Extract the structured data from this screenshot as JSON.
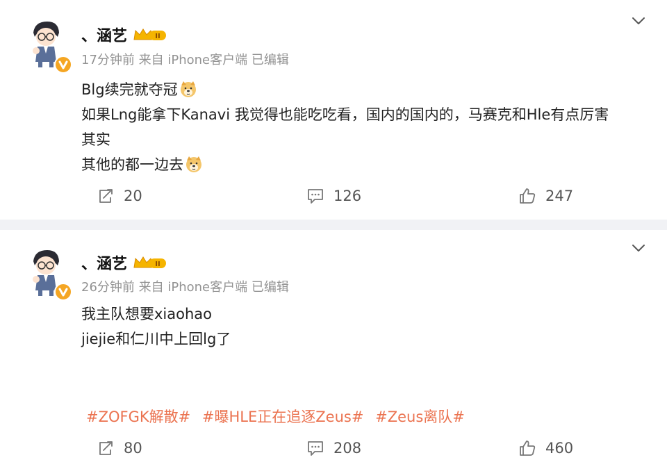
{
  "posts": [
    {
      "username": "、涵艺",
      "time": "17分钟前",
      "source": "来自 iPhone客户端",
      "edited": "已编辑",
      "lines": [
        "Blg续完就夺冠",
        "如果Lng能拿下Kanavi 我觉得也能吃吃看，国内的国内的，马赛克和Hle有点厉害",
        "其实",
        "其他的都一边去"
      ],
      "repost_count": "20",
      "comment_count": "126",
      "like_count": "247"
    },
    {
      "username": "、涵艺",
      "time": "26分钟前",
      "source": "来自 iPhone客户端",
      "edited": "已编辑",
      "lines": [
        "我主队想要xiaohao",
        "jiejie和仁川中上回lg了"
      ],
      "tags": [
        "#ZOFGK解散#",
        "#曝HLE正在追逐Zeus#",
        "#Zeus离队#"
      ],
      "repost_count": "80",
      "comment_count": "208",
      "like_count": "460"
    }
  ],
  "colors": {
    "tag": "#eb7350",
    "meta": "#939393",
    "divider": "#f1f2f5",
    "badge": "#f5a623"
  },
  "icons": {
    "repost": "repost-icon",
    "comment": "comment-icon",
    "like": "thumbs-up-icon",
    "menu": "chevron-down-icon",
    "emoji": "doge-emoji-icon",
    "verified": "verified-badge-icon",
    "vip": "crown-icon"
  }
}
